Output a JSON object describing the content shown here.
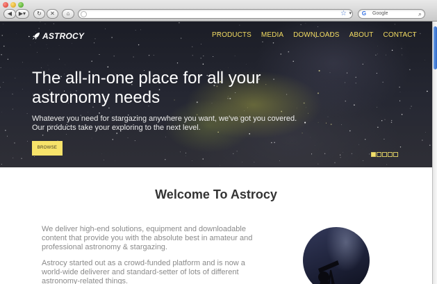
{
  "browser": {
    "search_placeholder": "Google",
    "google_label": "G"
  },
  "site": {
    "logo": "ASTROCY",
    "nav": [
      "PRODUCTS",
      "MEDIA",
      "DOWNLOADS",
      "ABOUT",
      "CONTACT"
    ],
    "accent_color": "#f4dd62"
  },
  "hero": {
    "title": "The all-in-one place for all your astronomy needs",
    "subtitle_line1": "Whatever you need for stargazing anywhere you want, we've got you covered.",
    "subtitle_line2": "Our products take your exploring to the next level.",
    "button": "BROWSE"
  },
  "main": {
    "heading": "Welcome To Astrocy",
    "paragraph1": "We deliver high-end solutions, equipment and downloadable content that provide you with the absolute best in amateur and professional astronomy & stargazing.",
    "paragraph2": "Astrocy started out as a crowd-funded platform and is now a world-wide deliverer and standard-setter of lots of different astronomy-related things."
  }
}
